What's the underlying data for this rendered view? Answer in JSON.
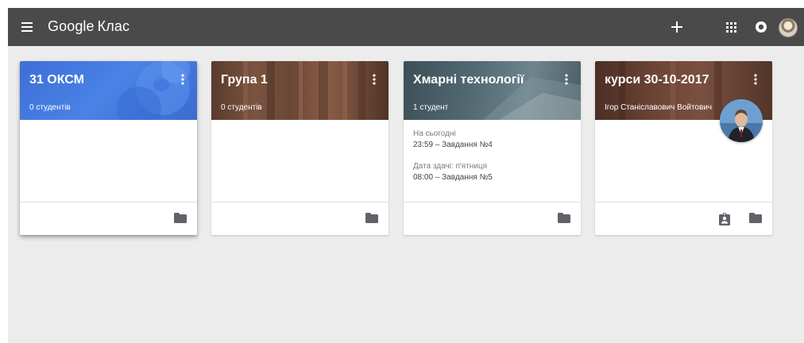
{
  "app": {
    "brand_google": "Google",
    "brand_product": "Клас"
  },
  "topbar": {
    "background": "#4a4a4a",
    "icons": [
      "menu-icon",
      "add-icon",
      "apps-grid-icon",
      "account-circle-icon",
      "user-avatar"
    ]
  },
  "classes": [
    {
      "title": "31 ОКСМ",
      "students": "0 студентів",
      "theme": "#4a82e6",
      "due": [],
      "teacher": "",
      "footer_icons": [
        "folder-icon"
      ]
    },
    {
      "title": "Група 1",
      "students": "0 студентів",
      "theme": "#6a4634",
      "due": [],
      "teacher": "",
      "footer_icons": [
        "folder-icon"
      ]
    },
    {
      "title": "Хмарні технології",
      "students": "1 студент",
      "theme": "#536a73",
      "due": [
        {
          "label": "На сьогодні",
          "item": "23:59 – Завдання №4"
        },
        {
          "label": "Дата здачі: п'ятниця",
          "item": "08:00 – Завдання №5"
        }
      ],
      "teacher": "",
      "footer_icons": [
        "folder-icon"
      ]
    },
    {
      "title": "курси 30-10-2017",
      "students": "Ігор Станіславович Войтович",
      "theme": "#6d4536",
      "due": [],
      "teacher": "Ігор Станіславович Войтович",
      "footer_icons": [
        "assignment-ind-icon",
        "folder-icon"
      ]
    }
  ]
}
